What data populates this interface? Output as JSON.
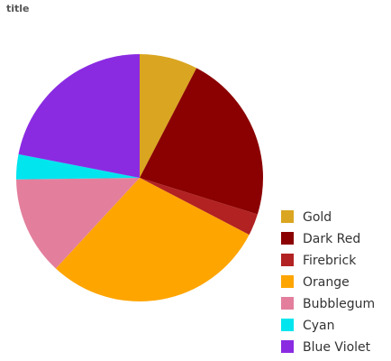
{
  "chart_data": {
    "type": "pie",
    "title": "title",
    "categories": [
      "Gold",
      "Dark Red",
      "Firebrick",
      "Orange",
      "Bubblegum",
      "Cyan",
      "Blue Violet"
    ],
    "values": [
      7.5,
      21.8,
      2.8,
      28.8,
      12.7,
      3.2,
      21.6
    ],
    "colors": [
      "#DAA520",
      "#8B0000",
      "#B22222",
      "#FFA500",
      "#E37F9D",
      "#00E5EE",
      "#8A2BE2"
    ],
    "legend_position": "right",
    "start_angle_deg": -90,
    "direction": "clockwise",
    "grid": false
  }
}
